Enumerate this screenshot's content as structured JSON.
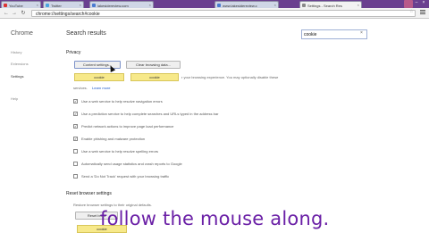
{
  "colors": {
    "tab_strip": "#6a3f8f",
    "highlight": "#f7e98a",
    "caption": "#6a1fa6",
    "link": "#1a57c9"
  },
  "tabs": [
    {
      "label": "YouTube",
      "favicon_color": "#d33"
    },
    {
      "label": "Twitter",
      "favicon_color": "#4aa3df"
    },
    {
      "label": "lakesidereview.com",
      "favicon_color": "#4a7bd0"
    },
    {
      "label": "www.lakesidereview.c",
      "favicon_color": "#4a7bd0"
    },
    {
      "label": "Settings - Search Res",
      "favicon_color": "#888"
    }
  ],
  "toolbar": {
    "url": "chrome://settings/search#cookie"
  },
  "sidebar": {
    "brand": "Chrome",
    "items": [
      {
        "label": "History"
      },
      {
        "label": "Extensions"
      },
      {
        "label": "Settings"
      },
      {
        "label": "Help"
      }
    ]
  },
  "header": {
    "title": "Search results"
  },
  "search": {
    "value": "cookie"
  },
  "privacy": {
    "section_title": "Privacy",
    "content_settings_button": "Content settings...",
    "clear_browsing_button": "Clear browsing data...",
    "highlight_a": "cookie",
    "highlight_b": "cookie",
    "description": "r your browsing experience. You may optionally disable these",
    "description_line2": "services.",
    "learn_more": "Learn more",
    "options": [
      {
        "label": "Use a web service to help resolve navigation errors",
        "checked": true
      },
      {
        "label": "Use a prediction service to help complete searches and URLs typed in the address bar",
        "checked": true
      },
      {
        "label": "Predict network actions to improve page load performance",
        "checked": true
      },
      {
        "label": "Enable phishing and malware protection",
        "checked": true
      },
      {
        "label": "Use a web service to help resolve spelling errors",
        "checked": false
      },
      {
        "label": "Automatically send usage statistics and crash reports to Google",
        "checked": false
      },
      {
        "label": "Send a 'Do Not Track' request with your browsing traffic",
        "checked": false
      }
    ]
  },
  "reset": {
    "section_title": "Reset browser settings",
    "description": "Restore browser settings to their original defaults.",
    "button": "Reset brow",
    "highlight": "cookie"
  },
  "caption": "follow the mouse along."
}
